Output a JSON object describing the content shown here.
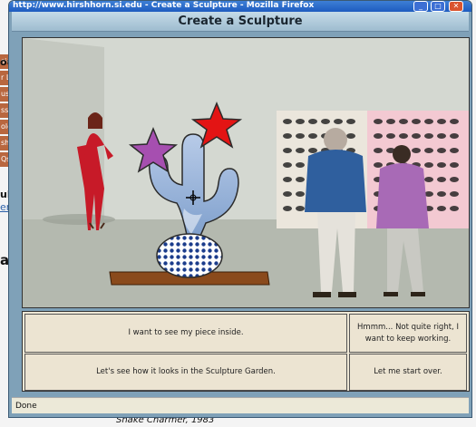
{
  "window": {
    "title": "http://www.hirshhorn.si.edu - Create a Sculpture - Mozilla Firefox",
    "minimize": "_",
    "maximize": "□",
    "close": "✕"
  },
  "dialog": {
    "header": "Create a Sculpture"
  },
  "background": {
    "nav_items": [
      "sion",
      "r Le",
      "us",
      "ss F",
      "olog",
      "shh",
      "Qs"
    ],
    "labels": [
      "out",
      "ulpt",
      "era",
      "ar"
    ],
    "footer_text": "Snake Charmer, 1983"
  },
  "choices": [
    {
      "label": "I want to see my piece inside."
    },
    {
      "label": "Hmmm... Not quite right, I want to keep working."
    },
    {
      "label": "Let's see how it looks in the Sculpture Garden."
    },
    {
      "label": "Let me start over."
    }
  ],
  "status": {
    "text": "Done"
  },
  "colors": {
    "star_purple": "#a64fb0",
    "star_red": "#e31414",
    "cactus_fill": "#9fb6da",
    "base_dots": "#1c3d8c",
    "plank": "#8a4a1c"
  }
}
